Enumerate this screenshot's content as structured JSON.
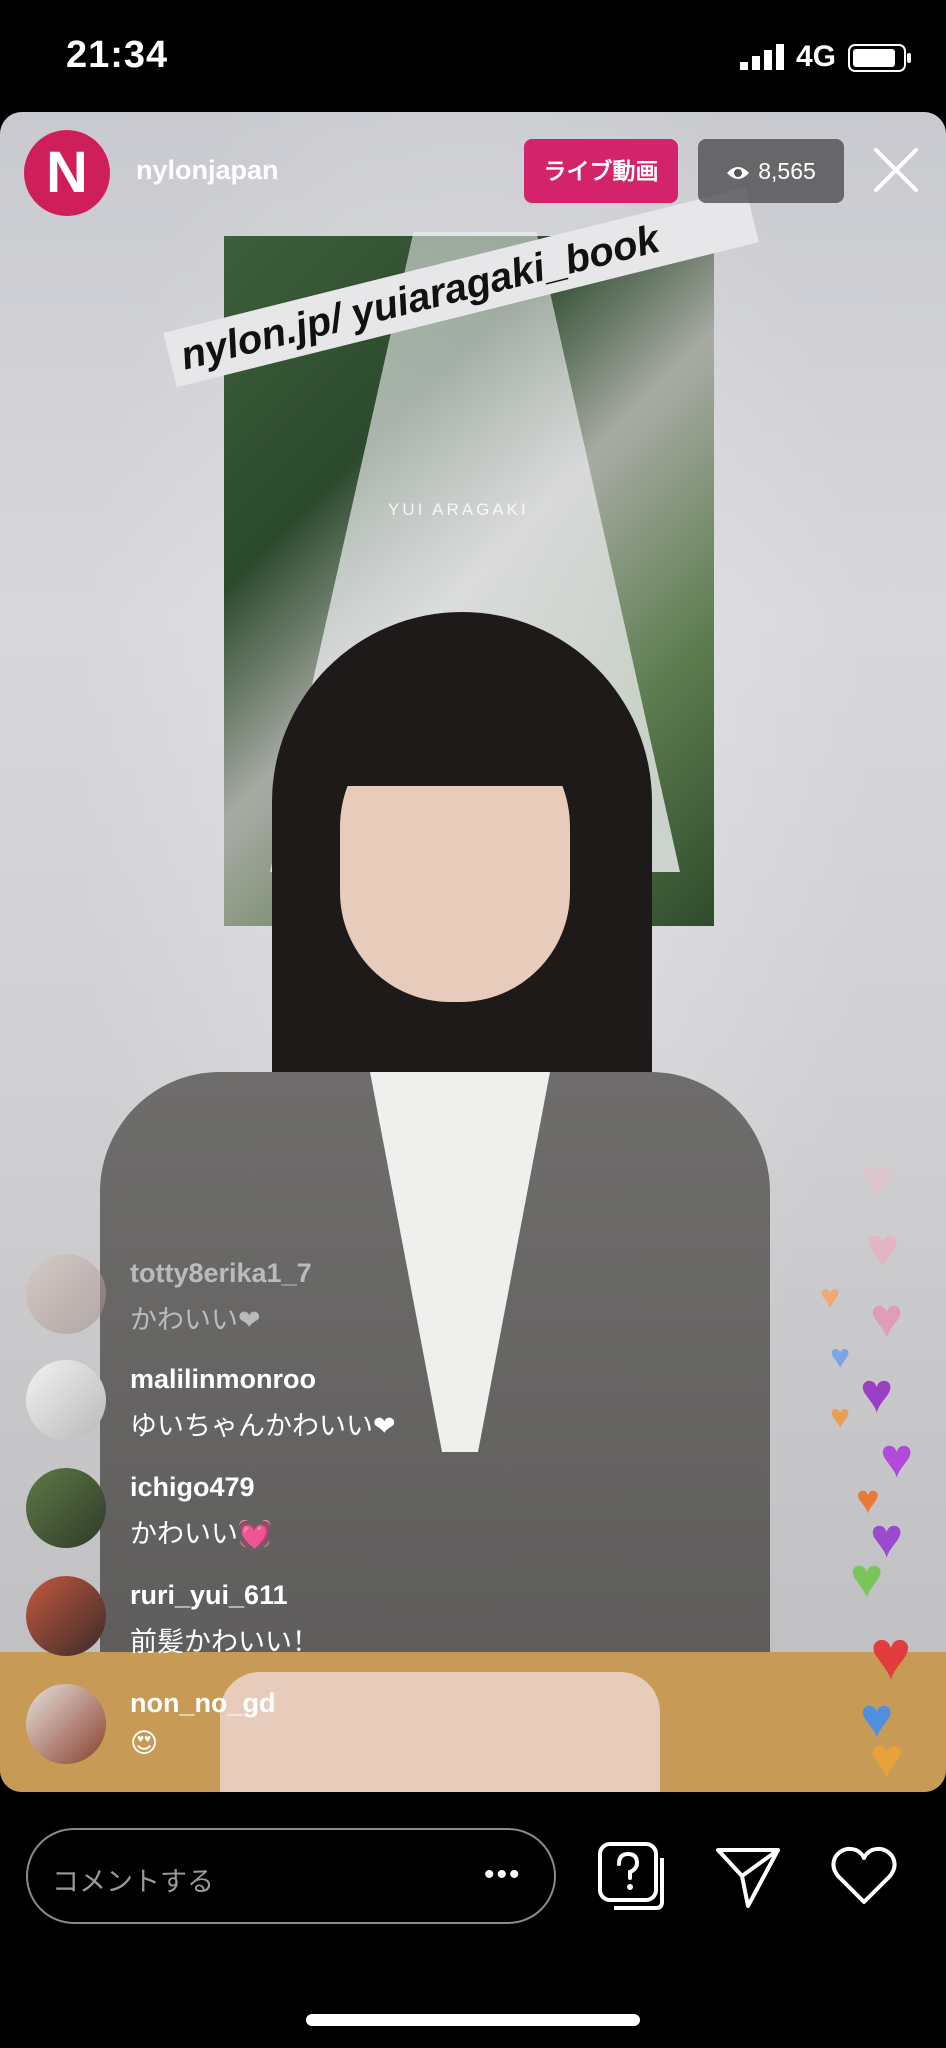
{
  "status_bar": {
    "time": "21:34",
    "network": "4G",
    "icons": [
      "signal-icon",
      "battery-icon"
    ]
  },
  "broadcast": {
    "host_initial": "N",
    "host_handle": "nylonjapan",
    "live_label": "ライブ動画",
    "viewer_count": "8,565",
    "close_icon": "close-icon"
  },
  "video": {
    "overlay_url_text": "nylon.jp/ yuiaragaki_book",
    "poster_text": "YUI ARAGAKI"
  },
  "comments": [
    {
      "user": "totty8erika1_7",
      "text": "かわいい❤"
    },
    {
      "user": "malilinmonroo",
      "text": "ゆいちゃんかわいい❤"
    },
    {
      "user": "ichigo479",
      "text": "かわいい💓"
    },
    {
      "user": "ruri_yui_611",
      "text": "前髪かわいい！"
    },
    {
      "user": "non_no_gd",
      "text": "😍"
    }
  ],
  "composer": {
    "placeholder": "コメントする",
    "more": "•••",
    "icons": [
      "question-sticker-icon",
      "send-icon",
      "heart-icon"
    ]
  },
  "colors": {
    "live_badge": "#d3236a",
    "avatar_brand": "#cf1f5a"
  }
}
